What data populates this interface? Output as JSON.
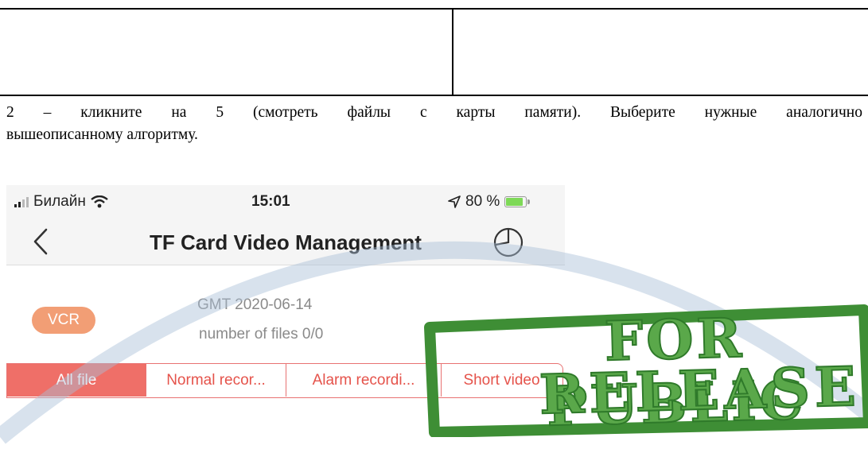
{
  "document": {
    "paragraph_line1": "2 – кликните на 5 (смотреть файлы с карты памяти). Выберите нужные аналогично",
    "paragraph_line2": "вышеописанному алгоритму."
  },
  "status_bar": {
    "carrier": "Билайн",
    "time": "15:01",
    "battery_percent": "80 %"
  },
  "nav": {
    "title": "TF Card Video Management"
  },
  "info": {
    "badge": "VCR",
    "date": "GMT 2020-06-14",
    "file_count": "number of files 0/0"
  },
  "tabs": [
    {
      "label": "All file",
      "active": true
    },
    {
      "label": "Normal recor..."
    },
    {
      "label": "Alarm recordi..."
    },
    {
      "label": "Short video"
    }
  ],
  "stamp": {
    "line1": "FOR PUBLIC",
    "line2": "RELEASE"
  },
  "colors": {
    "accent": "#ef6f68",
    "badge": "#f08e5e",
    "stamp": "#5aa84a"
  }
}
